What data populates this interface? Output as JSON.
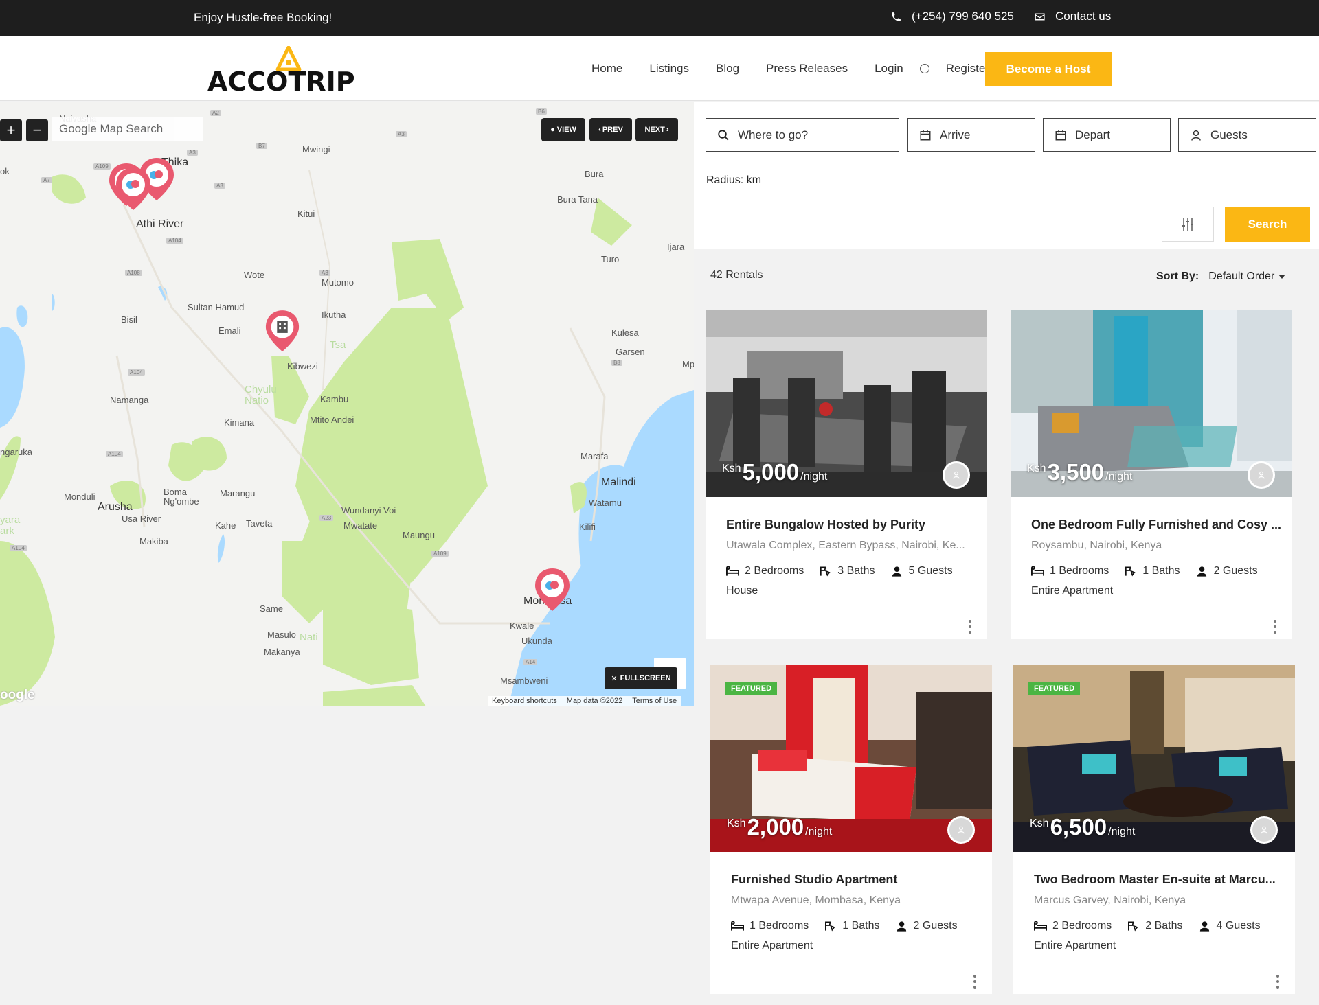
{
  "topbar": {
    "tagline": "Enjoy Hustle-free Booking!",
    "phone": "(+254) 799 640 525",
    "contact": "Contact us"
  },
  "header": {
    "logo_text": "ACCOTRIP",
    "nav": [
      "Home",
      "Listings",
      "Blog",
      "Press Releases"
    ],
    "login": "Login",
    "register": "Register",
    "host_button": "Become a Host",
    "accent_color": "#fbb714"
  },
  "map": {
    "search_placeholder": "Google Map Search",
    "zoom_in": "+",
    "zoom_out": "−",
    "view_label": "VIEW",
    "prev_label": "PREV",
    "next_label": "NEXT",
    "fullscreen_label": "FULLSCREEN",
    "footer": [
      "Keyboard shortcuts",
      "Map data ©2022",
      "Terms of Use"
    ],
    "google_label": "oogle",
    "places": [
      "Naivasha",
      "Thika",
      "Mwingi",
      "Athi River",
      "Kitui",
      "Wote",
      "Mutomo",
      "Sultan Hamud",
      "Emali",
      "Ikutha",
      "Bisil",
      "Mtito Andei",
      "Kibwezi",
      "Kambu",
      "Namanga",
      "Kimana",
      "Arusha",
      "Usa River",
      "Monduli",
      "Boma Ng'ombe",
      "Marangu",
      "Kahe",
      "Taveta",
      "Makiba",
      "Wundanyi Voi",
      "Mwatate",
      "Maungu",
      "Same",
      "Masulo",
      "Makanya",
      "Bura",
      "Bura Tana",
      "Turo",
      "Ijara",
      "Kulesa",
      "Garsen",
      "Marafa",
      "Malindi",
      "Watamu",
      "Kilifi",
      "Mombasa",
      "Kwale",
      "Ukunda",
      "Msambweni",
      "ngaruka",
      "Mp",
      "ok",
      "Chyulu Natio",
      "Tsa",
      "Nati",
      "yara ark"
    ],
    "roads": [
      "A2",
      "B6",
      "A3",
      "A3",
      "B7",
      "A3",
      "A104",
      "A108",
      "A104",
      "A104",
      "A104",
      "B8",
      "A23",
      "A109",
      "A14",
      "A109",
      "A7",
      "A3"
    ]
  },
  "search": {
    "where": "Where to go?",
    "arrive": "Arrive",
    "depart": "Depart",
    "guests": "Guests",
    "radius": "Radius: km",
    "search_button": "Search"
  },
  "results": {
    "count": "42 Rentals",
    "sort_label": "Sort By:",
    "sort_value": "Default Order"
  },
  "listings": [
    {
      "currency": "Ksh",
      "price": "5,000",
      "per": "/night",
      "title": "Entire Bungalow Hosted by Purity",
      "address": "Utawala Complex, Eastern Bypass, Nairobi, Ke...",
      "bedrooms": "2 Bedrooms",
      "baths": "3 Baths",
      "guests": "5 Guests",
      "type": "House",
      "featured": ""
    },
    {
      "currency": "Ksh",
      "price": "3,500",
      "per": "/night",
      "title": "One Bedroom Fully Furnished and Cosy ...",
      "address": "Roysambu, Nairobi, Kenya",
      "bedrooms": "1 Bedrooms",
      "baths": "1 Baths",
      "guests": "2 Guests",
      "type": "Entire Apartment",
      "featured": ""
    },
    {
      "currency": "Ksh",
      "price": "2,000",
      "per": "/night",
      "title": "Furnished Studio Apartment",
      "address": "Mtwapa Avenue, Mombasa, Kenya",
      "bedrooms": "1 Bedrooms",
      "baths": "1 Baths",
      "guests": "2 Guests",
      "type": "Entire Apartment",
      "featured": "FEATURED"
    },
    {
      "currency": "Ksh",
      "price": "6,500",
      "per": "/night",
      "title": "Two Bedroom Master En-suite at Marcu...",
      "address": "Marcus Garvey, Nairobi, Kenya",
      "bedrooms": "2 Bedrooms",
      "baths": "2 Baths",
      "guests": "4 Guests",
      "type": "Entire Apartment",
      "featured": "FEATURED"
    }
  ]
}
